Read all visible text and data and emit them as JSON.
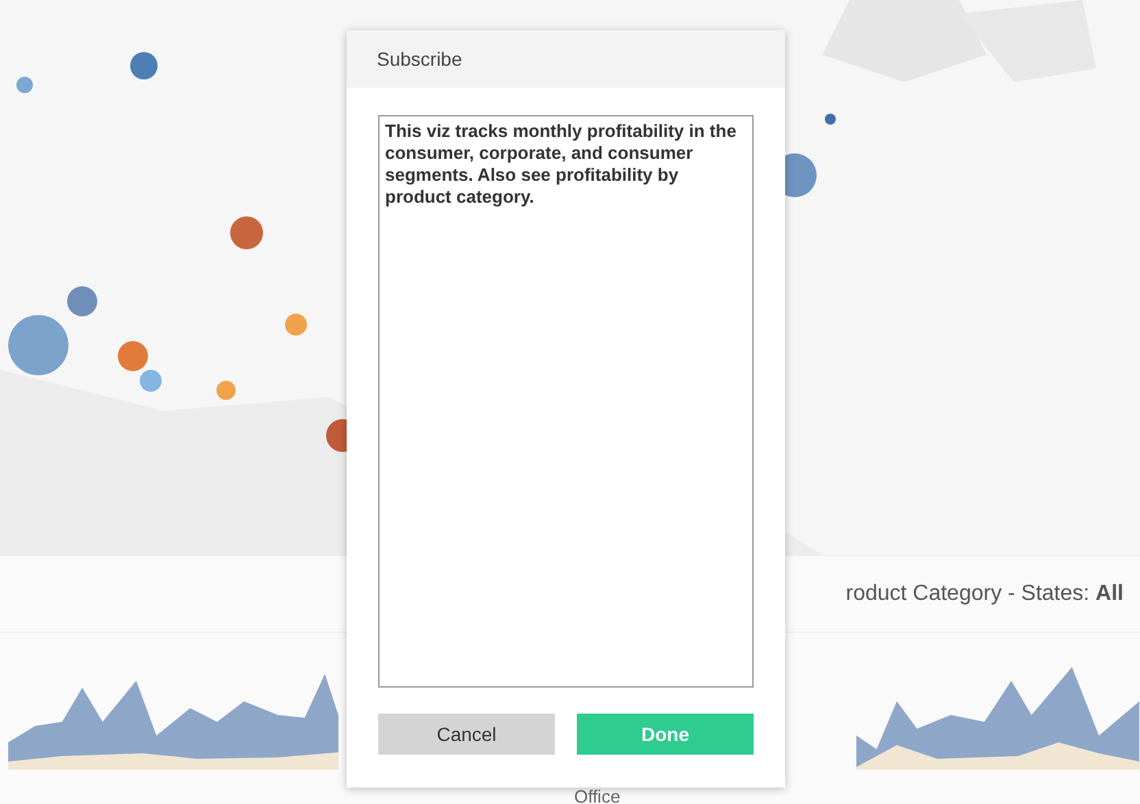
{
  "background": {
    "header": {
      "title": "roduct Category - States: **All**"
    },
    "axis_label": "Office"
  },
  "dialog": {
    "title": "Subscribe",
    "message": {
      "value": "This viz tracks monthly profitability in the consumer, corporate, and consumer segments. Also see profitability by product category."
    },
    "buttons": [
      {
        "label": "Cancel",
        "kind": "secondary"
      },
      {
        "label": "Done",
        "kind": "primary"
      }
    ]
  }
}
